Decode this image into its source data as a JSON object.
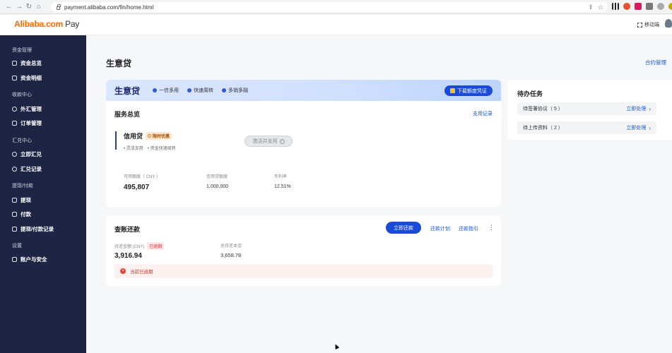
{
  "browser": {
    "url": "payment.alibaba.com/fin/home.html"
  },
  "header": {
    "logo_brand": "Alibaba.com",
    "logo_pay": "Pay",
    "mobile_label": "移动端"
  },
  "sidebar": {
    "groups": [
      {
        "label": "资金管理",
        "items": [
          "资金总览",
          "资金明细"
        ]
      },
      {
        "label": "收款中心",
        "items": [
          "外汇管理",
          "订单管理"
        ]
      },
      {
        "label": "汇兑中心",
        "items": [
          "立即汇兑",
          "汇兑记录"
        ]
      },
      {
        "label": "提现/付款",
        "items": [
          "提现",
          "付款",
          "提现/付款记录"
        ]
      },
      {
        "label": "设置",
        "items": [
          "账户与安全"
        ]
      }
    ]
  },
  "main": {
    "title": "生意贷",
    "contract_link": "合约管理",
    "banner": {
      "title": "生意贷",
      "tags": [
        "一信多用",
        "快速周转",
        "多销多融"
      ],
      "download_btn": "下载额度凭证"
    },
    "overview": {
      "title": "服务总览",
      "usage_link": "支用记录",
      "credit_name": "信用贷",
      "limited_badge": "限时优惠",
      "sub1": "灵活支用",
      "sub2": "资金快速周转",
      "activate_btn": "激活并支用",
      "stats": {
        "available_label": "可用额度（ CNY ）",
        "available_value": "495,807",
        "limit_label": "信用贷额度",
        "limit_value": "1,000,000",
        "rate_label": "年利率",
        "rate_value": "12.51%"
      }
    },
    "repay": {
      "title": "查账还款",
      "repay_btn": "立即还款",
      "plan_link": "还款计划",
      "guide_link": "还款指引",
      "more": "⋮",
      "due_label": "待还金额 (CNY)",
      "overdue_badge": "已逾期",
      "due_value": "3,916.94",
      "principal_label": "总待还本金",
      "principal_value": "3,658.78",
      "warning": "当前已逾期"
    },
    "todo": {
      "title": "待办任务",
      "items": [
        {
          "label": "待签署协议（ 5 ）",
          "action": "立即处理"
        },
        {
          "label": "待上传资料（ 2 ）",
          "action": "立即处理"
        }
      ]
    }
  }
}
